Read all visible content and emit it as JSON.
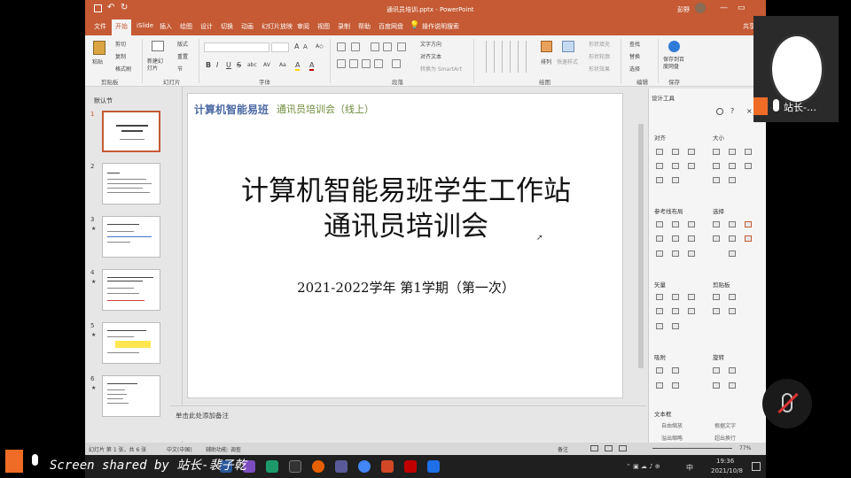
{
  "window": {
    "title": "通讯员培训.pptx - PowerPoint",
    "user": "彭野"
  },
  "tabs": [
    "文件",
    "开始",
    "iSlide",
    "插入",
    "绘图",
    "设计",
    "切换",
    "动画",
    "幻灯片放映",
    "审阅",
    "视图",
    "录制",
    "帮助",
    "百度网盘",
    "操作说明搜索"
  ],
  "share_label": "共享",
  "ribbon": {
    "clipboard": {
      "paste": "粘贴",
      "cut": "剪切",
      "copy": "复制",
      "format_painter": "格式刷",
      "group": "剪贴板"
    },
    "slides": {
      "new_slide": "新建幻灯片",
      "layout": "版式",
      "reset": "重置",
      "section": "节",
      "group": "幻灯片"
    },
    "font": {
      "group": "字体",
      "size": "24",
      "items": [
        "B",
        "I",
        "U",
        "S",
        "abc",
        "AV",
        "Aa",
        "A",
        "A"
      ]
    },
    "paragraph": {
      "group": "段落",
      "text_direction": "文字方向",
      "align_text": "对齐文本",
      "smartart": "转换为 SmartArt"
    },
    "drawing": {
      "group": "绘图",
      "arrange": "排列",
      "quick_styles": "快速样式",
      "fill": "形状填充",
      "outline": "形状轮廓",
      "effects": "形状效果"
    },
    "editing": {
      "group": "编辑",
      "find": "查找",
      "replace": "替换",
      "select": "选择"
    },
    "save": {
      "label": "保存到百度网盘",
      "group": "保存"
    }
  },
  "thumbs": {
    "section": "默认节",
    "numbers": [
      "1",
      "2",
      "3",
      "4",
      "5",
      "6"
    ]
  },
  "slide": {
    "header_left": "计算机智能易班",
    "header_right": "通讯员培训会（线上）",
    "title_line1": "计算机智能易班学生工作站",
    "title_line2": "通讯员培训会",
    "subtitle": "2021-2022学年 第1学期（第一次）"
  },
  "notes_placeholder": "单击此处添加备注",
  "design_panel": {
    "title": "设计工具",
    "sections": [
      "对齐",
      "大小",
      "参考线布局",
      "选择",
      "矢量",
      "剪贴板",
      "吸附",
      "旋转",
      "文本框"
    ],
    "textbox_opts": [
      "自由缩放",
      "根据文字",
      "溢出缩略",
      "超出换行"
    ]
  },
  "status": {
    "slide_info": "幻灯片 第 1 张，共 6 张",
    "lang": "中文(中国)",
    "accessibility": "辅助功能: 调查",
    "notes": "备注",
    "zoom": "77%"
  },
  "taskbar": {
    "time": "19:36",
    "date": "2021/10/8",
    "lang": "中"
  },
  "overlay": {
    "share_text": "Screen shared by 站长-裴子乾",
    "cam_name": "站长-…",
    "share_icon_color": "#ef6c26"
  }
}
